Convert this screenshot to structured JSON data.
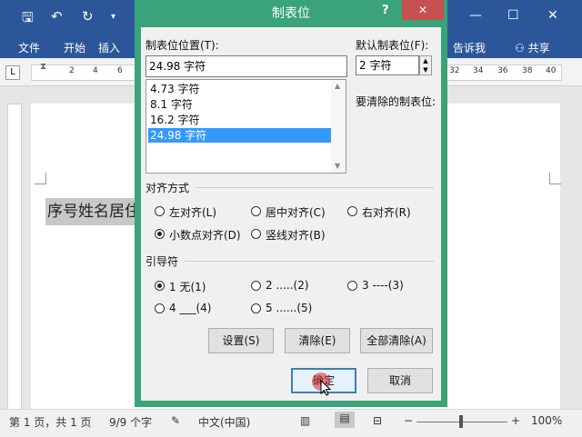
{
  "word": {
    "tabs": [
      "文件",
      "开始",
      "插入"
    ],
    "tell_me": "告诉我",
    "share": "共享",
    "ruler_numbers_left": [
      "2",
      "4",
      "6"
    ],
    "ruler_numbers_right": [
      "32",
      "34",
      "36",
      "38",
      "40"
    ],
    "doc_text": "序号姓名居住",
    "tab_selector": "L"
  },
  "status": {
    "page": "第 1 页，共 1 页",
    "words": "9/9 个字",
    "language": "中文(中国)",
    "zoom": "100%",
    "zoom_minus": "−",
    "zoom_plus": "+"
  },
  "dialog": {
    "title": "制表位",
    "help": "?",
    "close": "✕",
    "tab_position_label": "制表位位置(T):",
    "tab_position_value": "24.98 字符",
    "tab_list": [
      "4.73 字符",
      "8.1 字符",
      "16.2 字符",
      "24.98 字符"
    ],
    "default_label": "默认制表位(F):",
    "default_value": "2 字符",
    "clear_label": "要清除的制表位:",
    "align_group": "对齐方式",
    "align_options": [
      "左对齐(L)",
      "居中对齐(C)",
      "右对齐(R)",
      "小数点对齐(D)",
      "竖线对齐(B)"
    ],
    "leader_group": "引导符",
    "leader_options": [
      "1 无(1)",
      "2 .....(2)",
      "3 ----(3)",
      "4 ___(4)",
      "5 ......(5)"
    ],
    "buttons": {
      "set": "设置(S)",
      "clear": "清除(E)",
      "clear_all": "全部清除(A)",
      "ok": "确定",
      "cancel": "取消"
    }
  }
}
